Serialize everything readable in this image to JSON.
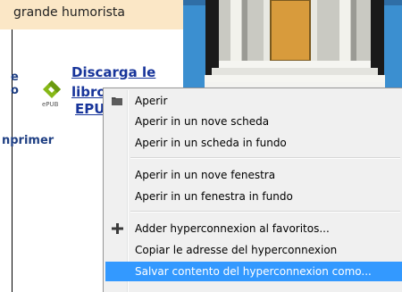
{
  "page": {
    "top_text": "grande humorista",
    "left_fragments": [
      "e",
      "o",
      "nprimer"
    ],
    "download_link": {
      "line1": "Discarga le",
      "line2": "libro",
      "line3": "EPU"
    },
    "epub_label": "ePUB"
  },
  "context_menu": {
    "items": [
      {
        "label": "Aperir",
        "icon": "folder-icon"
      },
      {
        "label": "Aperir in un nove scheda"
      },
      {
        "label": "Aperir in un scheda in fundo"
      },
      {
        "label": "Aperir in un nove fenestra"
      },
      {
        "label": "Aperir in un fenestra in fundo"
      },
      {
        "label": "Adder hyperconnexion al favoritos...",
        "icon": "plus-icon"
      },
      {
        "label": "Copiar le adresse del hyperconnexion"
      },
      {
        "label": "Salvar contento del hyperconnexion como...",
        "highlighted": true
      }
    ]
  },
  "colors": {
    "highlight": "#3399ff",
    "link": "#17349a",
    "top_strip": "#fbe7c6"
  }
}
